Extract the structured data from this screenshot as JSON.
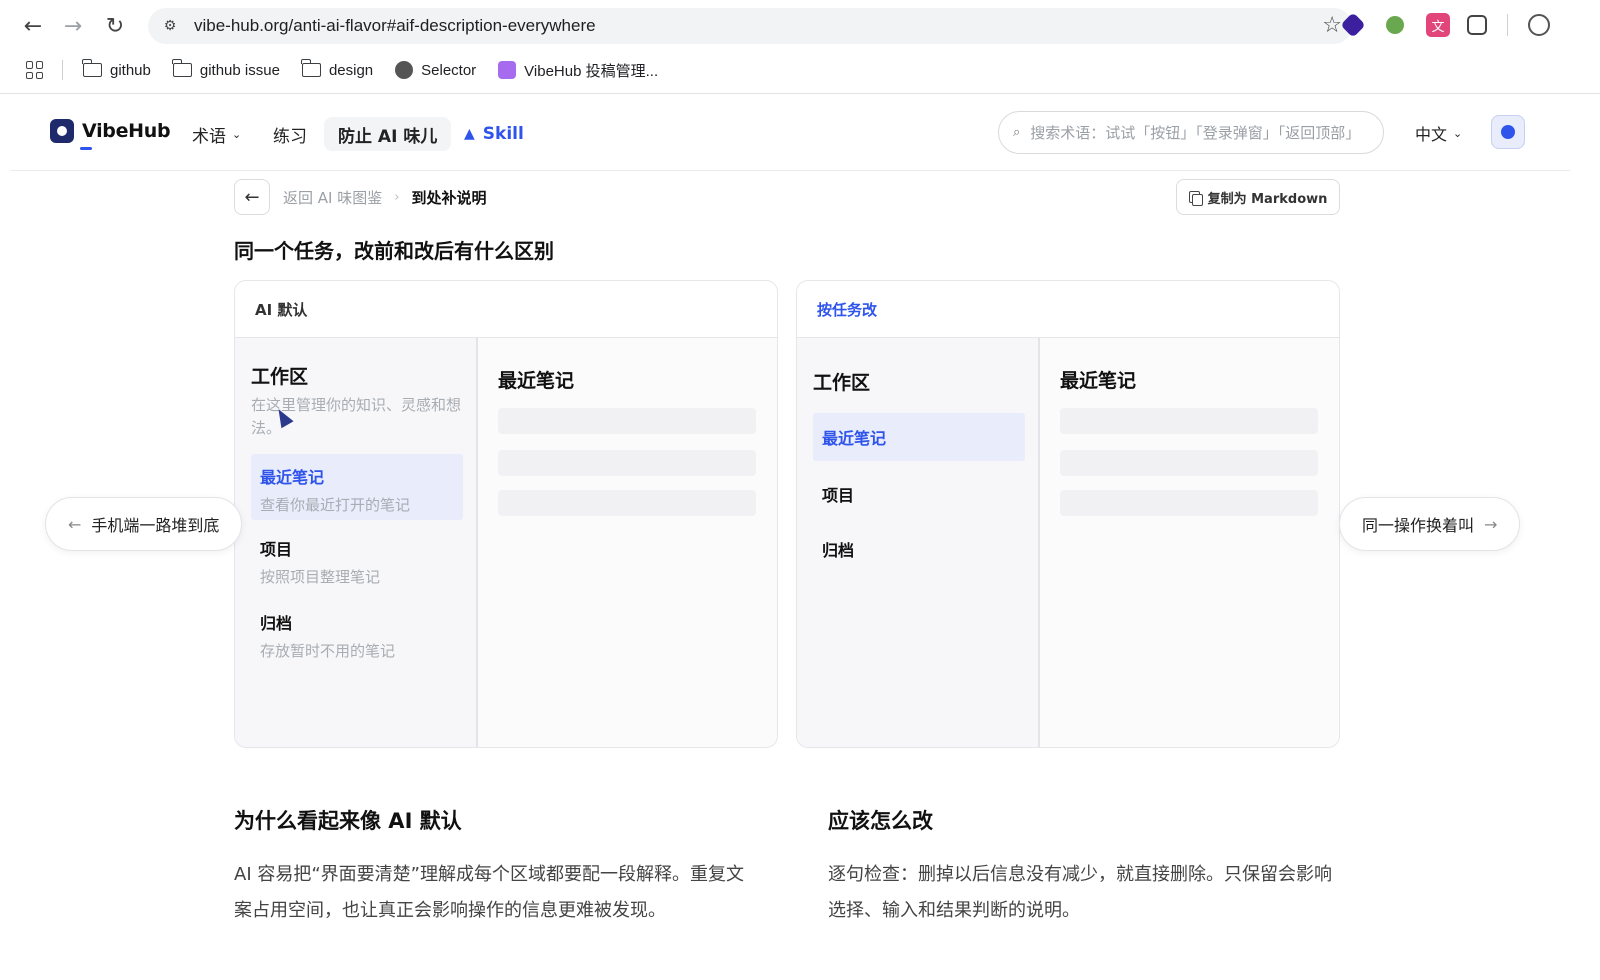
{
  "browser": {
    "url": "vibe-hub.org/anti-ai-flavor#aif-description-everywhere",
    "bookmarks": [
      "github",
      "github issue",
      "design",
      "Selector",
      "VibeHub 投稿管理..."
    ]
  },
  "header": {
    "logo": "VibeHub",
    "nav": {
      "terms": "术语",
      "practice": "练习",
      "anti_ai": "防止 AI 味儿",
      "skill": "Skill"
    },
    "search_placeholder": "搜索术语：试试「按钮」「登录弹窗」「返回顶部」",
    "language": "中文"
  },
  "breadcrumb": {
    "parent": "返回 AI 味图鉴",
    "current": "到处补说明"
  },
  "copy_button": "复制为 Markdown",
  "section_title": "同一个任务，改前和改后有什么区别",
  "panel_before": {
    "label": "AI 默认",
    "workspace_title": "工作区",
    "workspace_desc": "在这里管理你的知识、灵感和想法。",
    "items": [
      {
        "title": "最近笔记",
        "desc": "查看你最近打开的笔记"
      },
      {
        "title": "项目",
        "desc": "按照项目整理笔记"
      },
      {
        "title": "归档",
        "desc": "存放暂时不用的笔记"
      }
    ],
    "main_title": "最近笔记"
  },
  "panel_after": {
    "label": "按任务改",
    "workspace_title": "工作区",
    "items": [
      "最近笔记",
      "项目",
      "归档"
    ],
    "main_title": "最近笔记"
  },
  "prev_link": "手机端一路堆到底",
  "next_link": "同一操作换着叫",
  "why": {
    "title": "为什么看起来像 AI 默认",
    "body": "AI 容易把“界面要清楚”理解成每个区域都要配一段解释。重复文案占用空间，也让真正会影响操作的信息更难被发现。"
  },
  "how": {
    "title": "应该怎么改",
    "body": "逐句检查：删掉以后信息没有减少，就直接删除。只保留会影响选择、输入和结果判断的说明。"
  },
  "colors": {
    "accent": "#2f54eb",
    "selected_bg": "#e8ecfb"
  }
}
